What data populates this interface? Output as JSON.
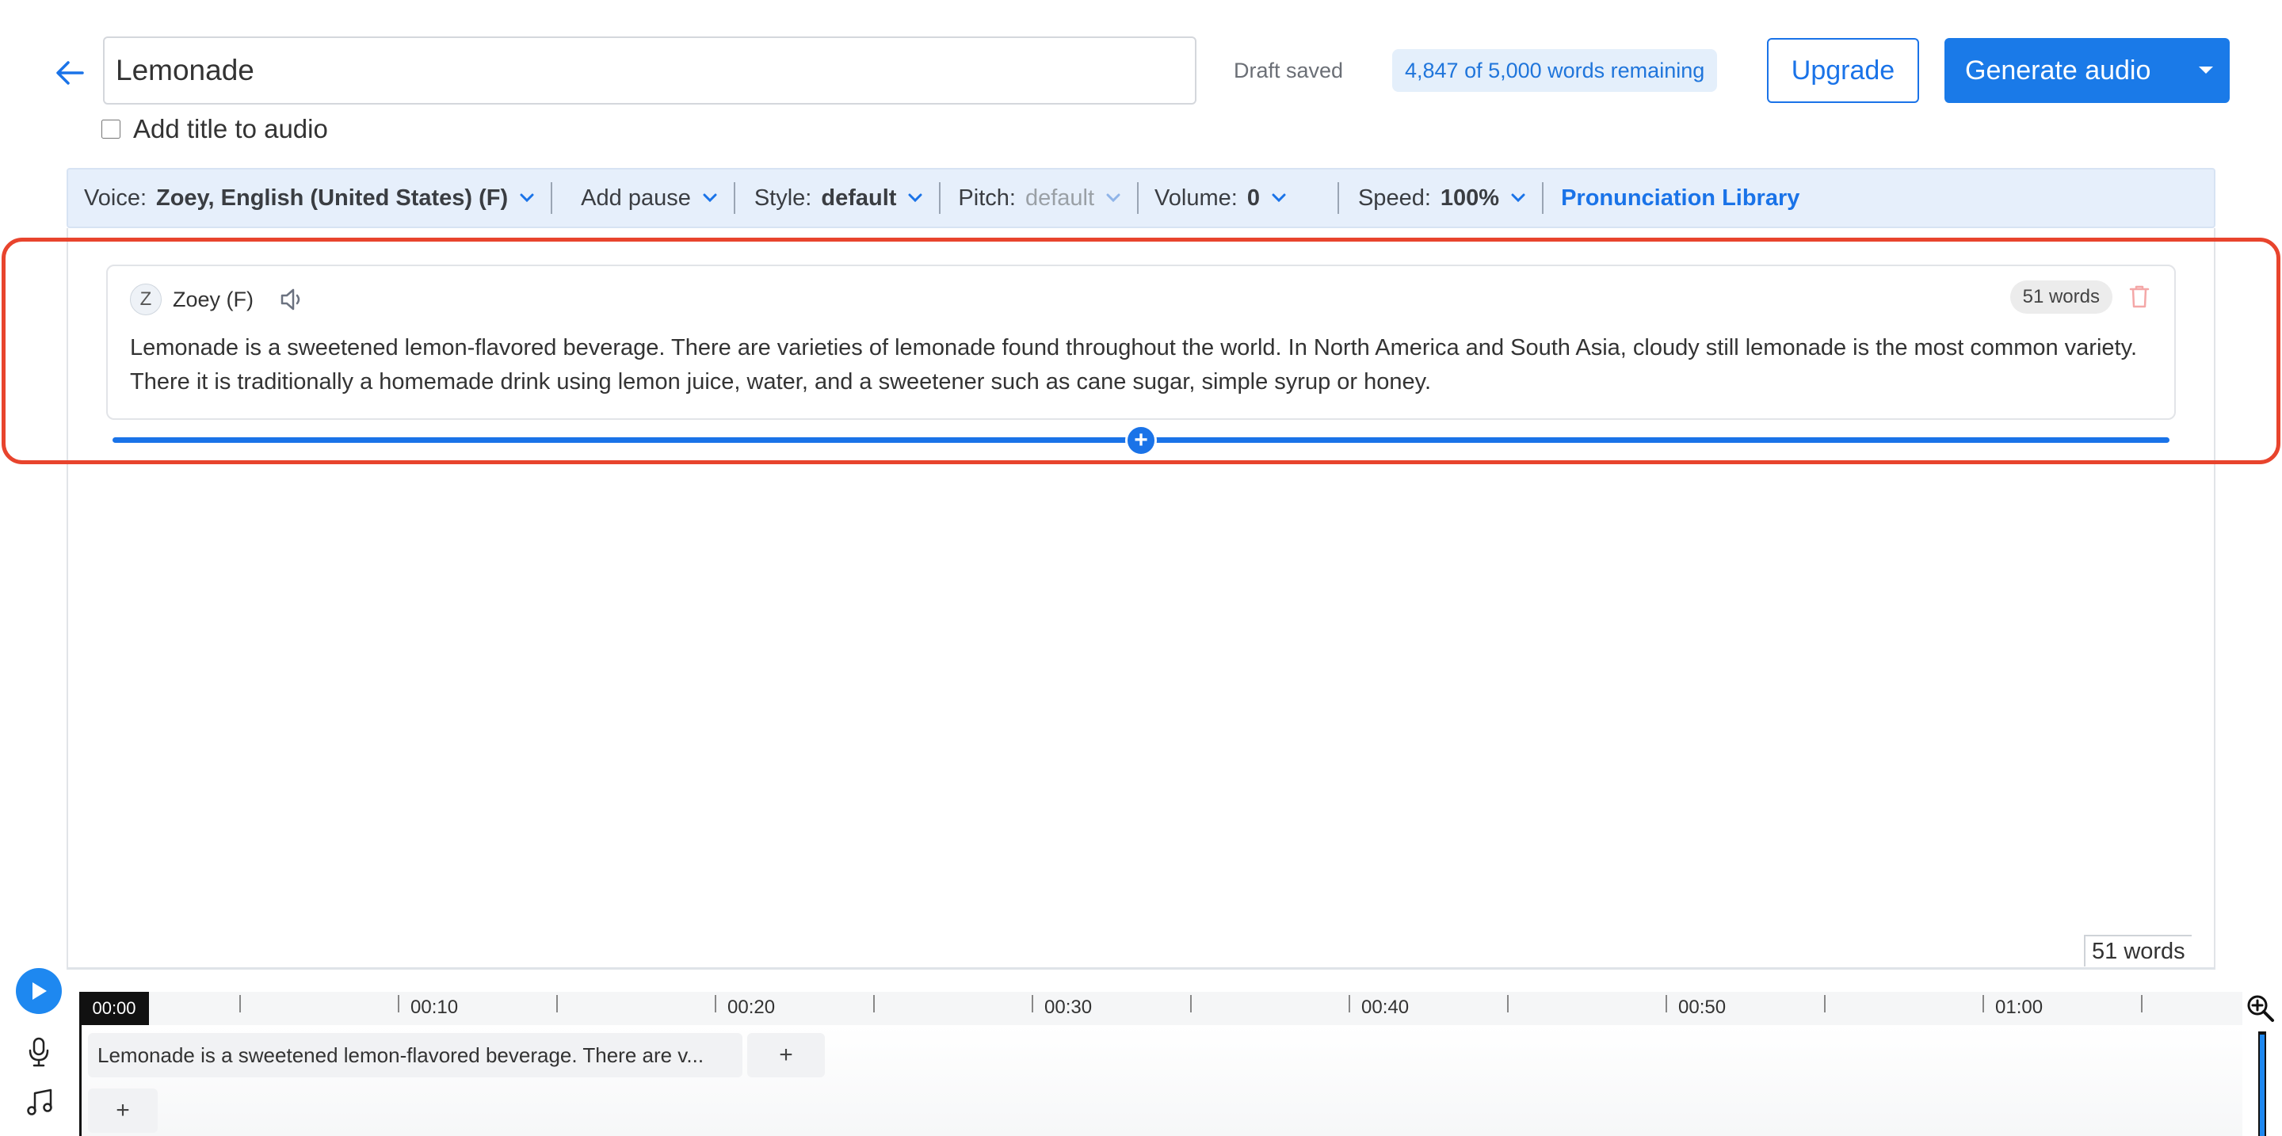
{
  "header": {
    "title_value": "Lemonade",
    "add_title_label": "Add title to audio",
    "draft_status": "Draft saved",
    "words_remaining": "4,847 of 5,000 words remaining",
    "upgrade_label": "Upgrade",
    "generate_label": "Generate audio"
  },
  "toolbar": {
    "voice_key": "Voice:",
    "voice_value": "Zoey, English (United States) (F)",
    "add_pause": "Add pause",
    "style_key": "Style:",
    "style_value": "default",
    "pitch_key": "Pitch:",
    "pitch_value": "default",
    "volume_key": "Volume:",
    "volume_value": "0",
    "speed_key": "Speed:",
    "speed_value": "100%",
    "pronunciation": "Pronunciation Library"
  },
  "block": {
    "avatar_letter": "Z",
    "voice_name": "Zoey (F)",
    "word_count": "51 words",
    "text": "Lemonade is a sweetened lemon-flavored beverage. There are varieties of lemonade found throughout the world. In North America and South Asia, cloudy still lemonade is the most common variety. There it is traditionally a homemade drink using lemon juice, water, and a sweetener such as cane sugar, simple syrup or honey.",
    "add_symbol": "+"
  },
  "footer": {
    "total_words": "51 words"
  },
  "timeline": {
    "start_time": "00:00",
    "labels": [
      "00:10",
      "00:20",
      "00:30",
      "00:40",
      "00:50",
      "01:00"
    ],
    "clip_text": "Lemonade is a sweetened lemon-flavored beverage. There are v...",
    "add_symbol": "+"
  },
  "icons": {
    "back": "arrow-left-icon",
    "speaker": "speaker-icon",
    "trash": "trash-icon",
    "play": "play-icon",
    "mic": "microphone-icon",
    "music": "music-note-icon",
    "zoom": "zoom-in-icon",
    "chevron": "chevron-down-icon"
  },
  "colors": {
    "accent": "#1a73e8",
    "highlight": "#e8442d",
    "toolbar_bg": "#e6effb"
  }
}
